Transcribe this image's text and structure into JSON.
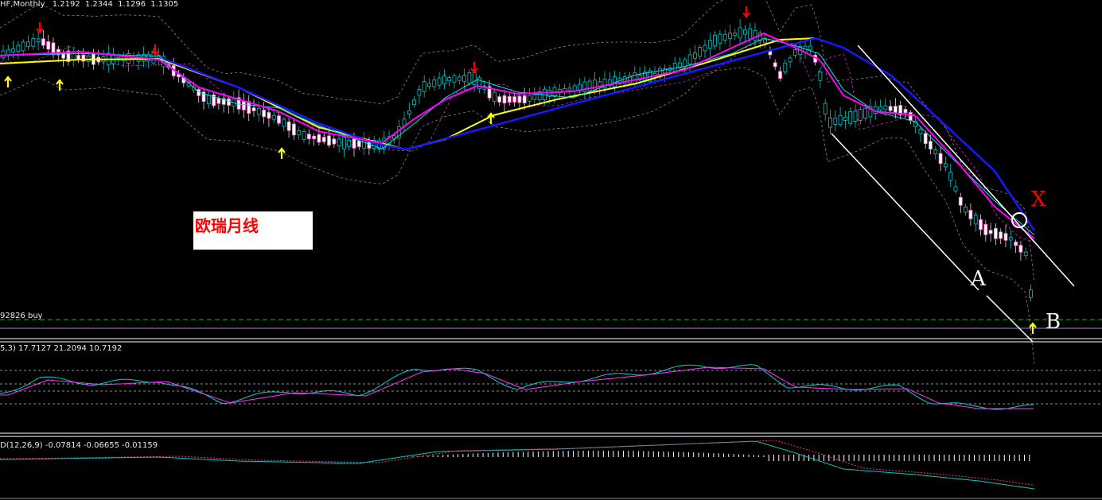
{
  "main_chart": {
    "header": {
      "symbol": "HF,Monthly",
      "ohlc": [
        "1.2192",
        "1.2344",
        "1.1296",
        "1.1305"
      ]
    },
    "order_label": "92826 buy",
    "annotation": "欧瑞月线",
    "markers": {
      "x": "X",
      "a": "A",
      "b": "B"
    }
  },
  "stoch_panel": {
    "header": "5,3) 17.7127 21.2094 10.7192"
  },
  "macd_panel": {
    "header": "D(12,26,9) -0.07814 -0.06655 -0.01159"
  },
  "colors": {
    "background": "#000000",
    "ma_yellow": "#ffff00",
    "ma_blue": "#1818ff",
    "ma_magenta": "#ff00ff",
    "ma_cyan": "#00e5e5",
    "bull_candle": "#00c8c8",
    "bear_candle": "#ffffff",
    "arrow_down": "#ff0000",
    "arrow_up": "#ffff00",
    "channel_lines": "#ffffff",
    "order_line": "#00c000",
    "marker_x": "#ff0000"
  }
}
